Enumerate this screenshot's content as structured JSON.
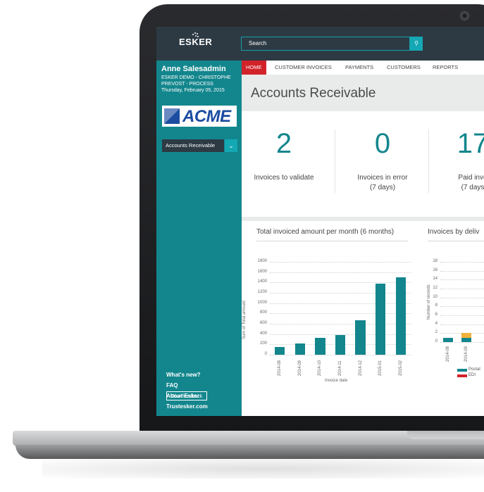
{
  "app": {
    "logo": "ESKER"
  },
  "search": {
    "placeholder": "Search",
    "button_icon": "search-icon"
  },
  "user": {
    "name": "Anne Salesadmin",
    "lines": [
      "ESKER DEMO - CHRISTOPHE",
      "PREVOST - PROCESS",
      "Thursday, February 05, 2015"
    ]
  },
  "company": {
    "logo_text": "ACME"
  },
  "view_selector": {
    "value": "Accounts Receivable",
    "button_icon": "chevron-down-icon"
  },
  "nav": {
    "tabs": [
      "HOME",
      "CUSTOMER INVOICES",
      "PAYMENTS",
      "CUSTOMERS",
      "REPORTS"
    ],
    "active": "HOME"
  },
  "page": {
    "title": "Accounts Receivable"
  },
  "kpis": [
    {
      "value": "2",
      "label": "Invoices to validate",
      "label2": ""
    },
    {
      "value": "0",
      "label": "Invoices in error",
      "label2": "(7 days)"
    },
    {
      "value": "17",
      "label": "Paid invo",
      "label2": "(7 days"
    }
  ],
  "sidebar_links": [
    "What's new?",
    "FAQ",
    "About Esker",
    "Trustesker.com"
  ],
  "feedback_button": "Give feedback",
  "colors": {
    "accent": "#13868d",
    "active_tab": "#d2232a",
    "topbar": "#2d3a44",
    "edi": "#d2232a",
    "other": "#f0b23a"
  },
  "chart_data": [
    {
      "type": "bar",
      "title": "Total invoiced amount per month (6 months)",
      "xlabel": "Invoice date",
      "ylabel": "Sum of Total amount",
      "categories": [
        "2014-08",
        "2014-09",
        "2014-10",
        "2014-11",
        "2014-12",
        "2015-01",
        "2015-02"
      ],
      "values": [
        150,
        220,
        330,
        380,
        670,
        1380,
        1500
      ],
      "ylim": [
        0,
        1800
      ],
      "yticks": [
        "0",
        "200",
        "400",
        "600",
        "800",
        "1000",
        "1200",
        "1400",
        "1600",
        "1800"
      ],
      "grid": true
    },
    {
      "type": "bar",
      "title": "Invoices by deliv",
      "ylabel": "Number of records",
      "categories": [
        "2014-08",
        "2014-09"
      ],
      "series": [
        {
          "name": "Postal",
          "values": [
            1,
            1
          ]
        },
        {
          "name": "EDI",
          "values": [
            0,
            0
          ]
        },
        {
          "values": [
            0,
            1
          ]
        }
      ],
      "ylim": [
        0,
        18
      ],
      "yticks": [
        "0",
        "2",
        "4",
        "6",
        "8",
        "10",
        "12",
        "14",
        "16",
        "18"
      ],
      "grid": true,
      "legend": "bottom"
    }
  ]
}
